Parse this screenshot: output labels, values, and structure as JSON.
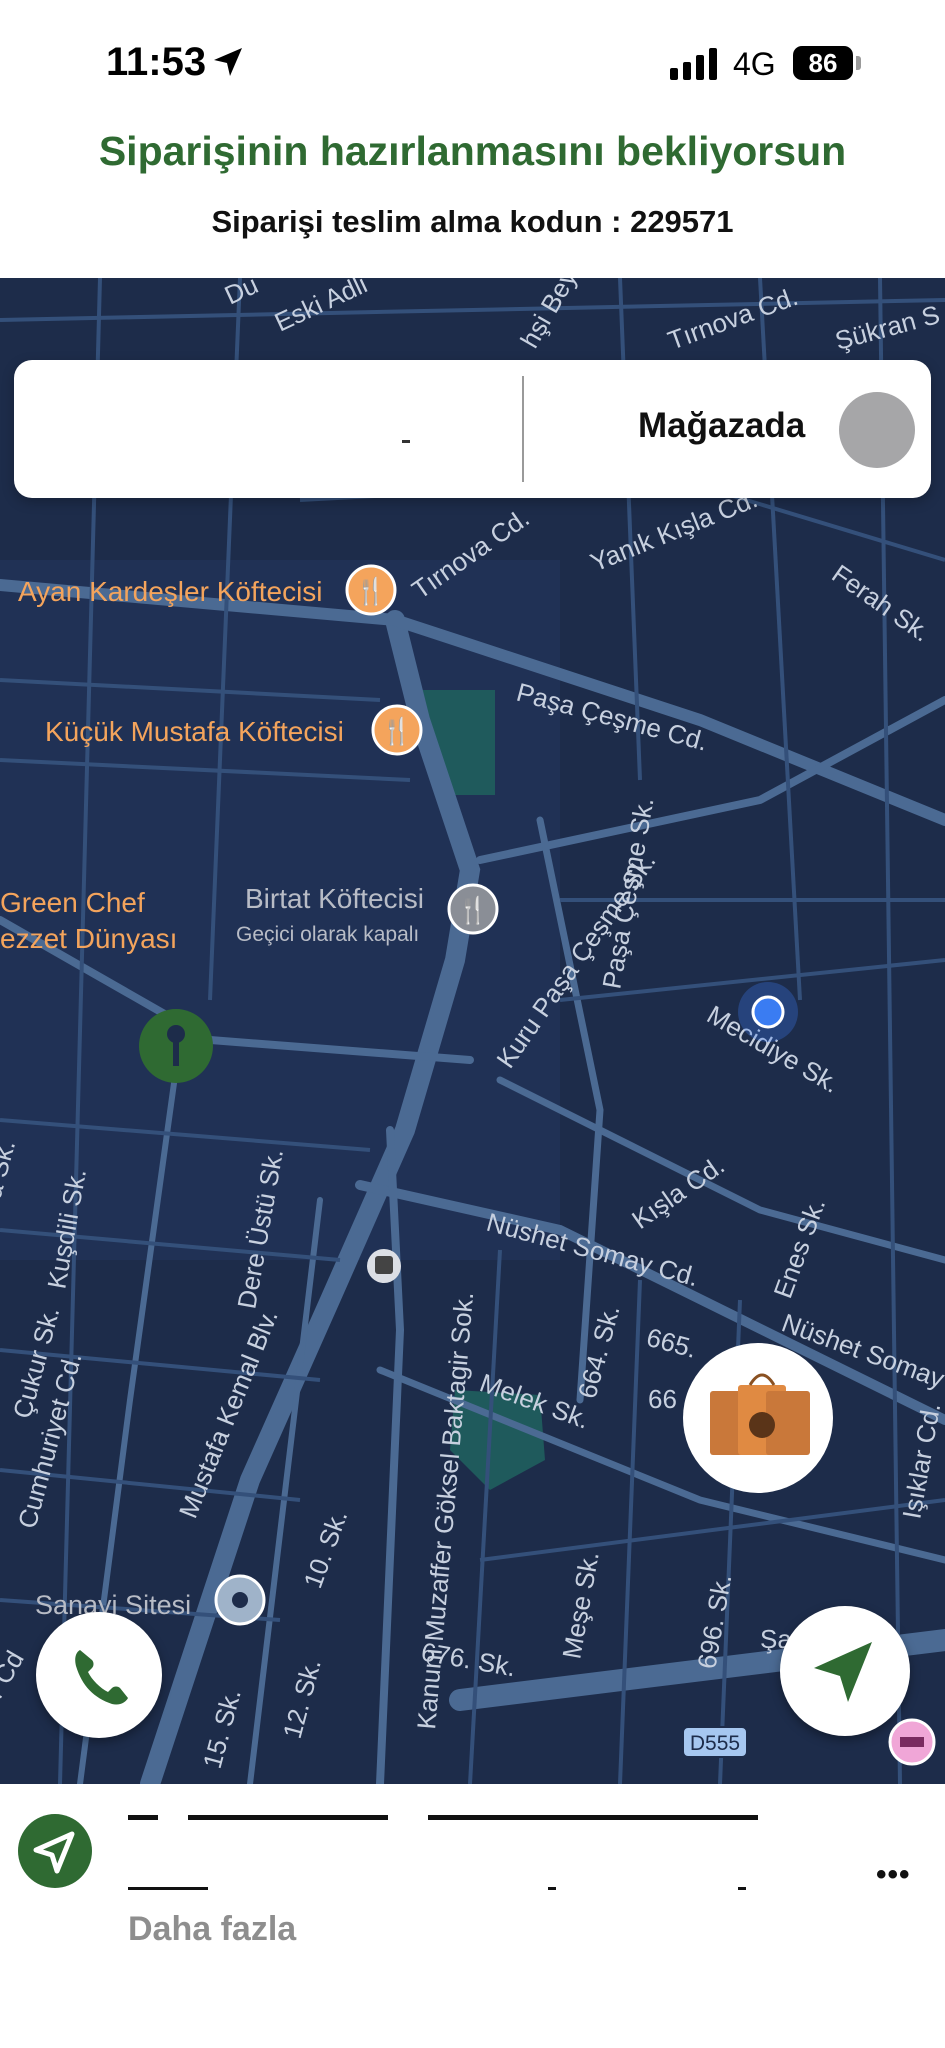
{
  "status_bar": {
    "time": "11:53",
    "network": "4G",
    "battery": "86",
    "icons": [
      "location-arrow-icon",
      "cellular-signal-icon",
      "battery-icon"
    ]
  },
  "header": {
    "title": "Siparişinin hazırlanmasını bekliyorsun",
    "code_text": "Siparişi teslim alma kodun : 229571"
  },
  "order_status_card": {
    "status_label": "Mağazada"
  },
  "map": {
    "street_labels": [
      "Eski Adli",
      "Du",
      "Tırnova Cd.",
      "Şükran S",
      "Tırnova Cd.",
      "Yanık Kışla Cd.",
      "Ferah Sk.",
      "Paşa Çeşme Cd.",
      "Paşa Çeşme Sk.",
      "Kuru Paşa Çeşme Sk.",
      "Mecidiye Sk.",
      "Kışla Cd.",
      "Nüshet Somay Cd.",
      "Nüshet Somay",
      "Enes Sk.",
      "Kuşdili Sk.",
      "Dere Üstü Sk.",
      "Çukur Sk.",
      "Cumhuriyet Cd.",
      "Mustafa Kemal Blv.",
      "Kanuni Muzaffer Göksel Baktagir Sok.",
      "664. Sk.",
      "665.",
      "66",
      "Melek Sk.",
      "10. Sk.",
      "676. Sk.",
      "Meşe Sk.",
      "696. Sk.",
      "12. Sk.",
      "15. Sk.",
      "Işıklar Cd.",
      "a Sk.",
      "r Cd",
      "Şa",
      "hşi Bey"
    ],
    "places": [
      {
        "name": "Ayan Kardeşler Köftecisi",
        "icon": "restaurant-icon"
      },
      {
        "name": "Küçük Mustafa Köftecisi",
        "icon": "restaurant-icon"
      },
      {
        "name": "Birtat Köftecisi",
        "subtitle": "Geçici olarak kapalı",
        "icon": "restaurant-icon"
      },
      {
        "name": "Green Chef",
        "icon": ""
      },
      {
        "name": "ezzet Dünyası",
        "icon": ""
      },
      {
        "name": "Sanayi Sitesi",
        "icon": "place-pin-icon"
      }
    ],
    "road_badge": "D555",
    "colors": {
      "background": "#1d2c4a",
      "road": "#3e5a80",
      "poi": "#f4a45c",
      "accent_green": "#2f6a32",
      "user_location": "#3a7cf2"
    }
  },
  "bottom_sheet": {
    "more_link": "Daha fazla",
    "more_icon": "ellipsis-icon"
  }
}
